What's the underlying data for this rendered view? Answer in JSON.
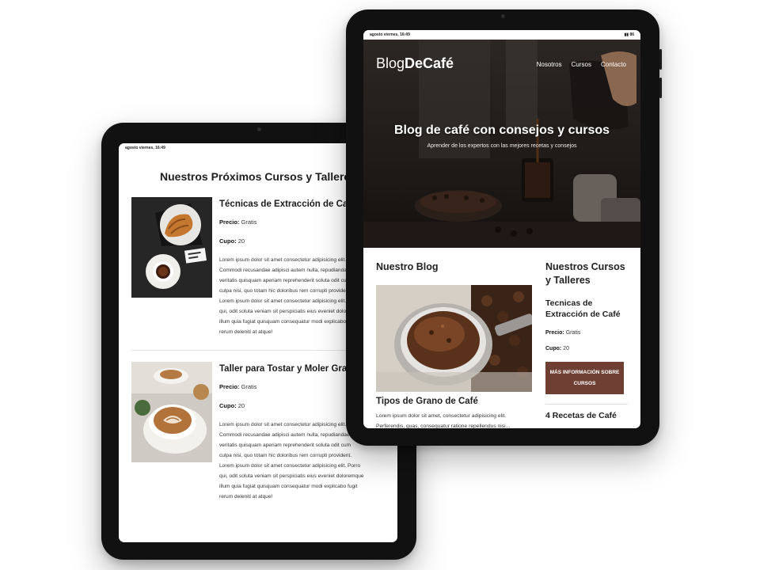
{
  "status_bar": {
    "time": "agosto viernes, 16:49",
    "battery": "86"
  },
  "back_page": {
    "heading": "Nuestros Próximos Cursos y Talleres",
    "courses": [
      {
        "title": "Técnicas de Extracción de Café",
        "price_label": "Precio:",
        "price": "Gratis",
        "quota_label": "Cupo:",
        "quota": "20",
        "description": "Lorem ipsum dolor sit amet consectetur adipisicing elit.\nCommodi recusandae adipisci autem nulla, repudiandae\nveritatis quisquam aperiam reprehenderit soluta odit cum\nculpa nisi, quo totam hic doloribus rem corrupti provident.\nLorem ipsum dolor sit amet consectetur adipisicing elit. Porro\nqui, odit soluta veniam sit perspiciatis eius eveniet doloremque\nillum quia fugiat quisquam consequatur modi explicabo fugit\nrerum deleniti at atque!"
      },
      {
        "title": "Taller para Tostar y Moler Grano",
        "price_label": "Precio:",
        "price": "Gratis",
        "quota_label": "Cupo:",
        "quota": "20",
        "description": "Lorem ipsum dolor sit amet consectetur adipisicing elit.\nCommodi recusandae adipisci autem nulla, repudiandae\nveritatis quisquam aperiam reprehenderit soluta odit cum\nculpa nisi, quo totam hic doloribus rem corrupti provident.\nLorem ipsum dolor sit amet consectetur adipisicing elit. Porro\nqui, odit soluta veniam sit perspiciatis eius eveniet doloremque\nillum quia fugiat quisquam consequatur modi explicabo fugit\nrerum deleniti at atque!"
      }
    ]
  },
  "front_page": {
    "logo_light": "Blog",
    "logo_bold": "DeCafé",
    "nav": [
      "Nosotros",
      "Cursos",
      "Contacto"
    ],
    "hero_title": "Blog de café con consejos y cursos",
    "hero_subtitle": "Aprender de los expertos con las mejores recetas y consejos",
    "blog_heading": "Nuestro Blog",
    "post_title": "Tipos de Grano de Café",
    "post_excerpt": "Lorem ipsum dolor sit amet, consectetur adipisicing elit. Perferendis, quas, consequatur ratione repellendus nisi...",
    "side_heading": "Nuestros Cursos y Talleres",
    "side_course_title": "Tecnicas de Extracción de Café",
    "side_price_label": "Precio:",
    "side_price": "Gratis",
    "side_quota_label": "Cupo:",
    "side_quota": "20",
    "more_button": "Más Información sobre cursos",
    "side_recipe": "4 Recetas de Café"
  },
  "colors": {
    "button": "#6f3f33",
    "frame": "#111111"
  }
}
